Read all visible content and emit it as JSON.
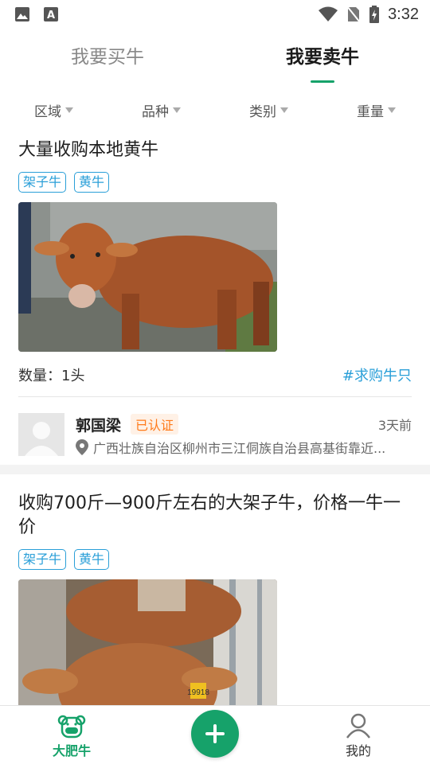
{
  "status_bar": {
    "time": "3:32"
  },
  "tabs": [
    {
      "label": "我要买牛",
      "active": false
    },
    {
      "label": "我要卖牛",
      "active": true
    }
  ],
  "filters": [
    {
      "label": "区域"
    },
    {
      "label": "品种"
    },
    {
      "label": "类别"
    },
    {
      "label": "重量"
    }
  ],
  "posts": [
    {
      "title": "大量收购本地黄牛",
      "tags": [
        "架子牛",
        "黄牛"
      ],
      "quantity": "数量：1头",
      "hashtag": "#求购牛只",
      "user": {
        "name": "郭国梁",
        "badge": "已认证",
        "time": "3天前",
        "location": "广西壮族自治区柳州市三江侗族自治县高基街靠近..."
      }
    },
    {
      "title": "收购700斤—900斤左右的大架子牛，价格一牛一价",
      "tags": [
        "架子牛",
        "黄牛"
      ],
      "ear_tag": "19918"
    }
  ],
  "bottom_nav": [
    {
      "label": "大肥牛",
      "active": true,
      "icon": "cow-icon"
    },
    {
      "label": "add",
      "icon": "plus-icon"
    },
    {
      "label": "我的",
      "active": false,
      "icon": "person-icon"
    }
  ],
  "colors": {
    "accent": "#16a26a",
    "link": "#2a9fd8",
    "badge": "#ff7a1a"
  }
}
